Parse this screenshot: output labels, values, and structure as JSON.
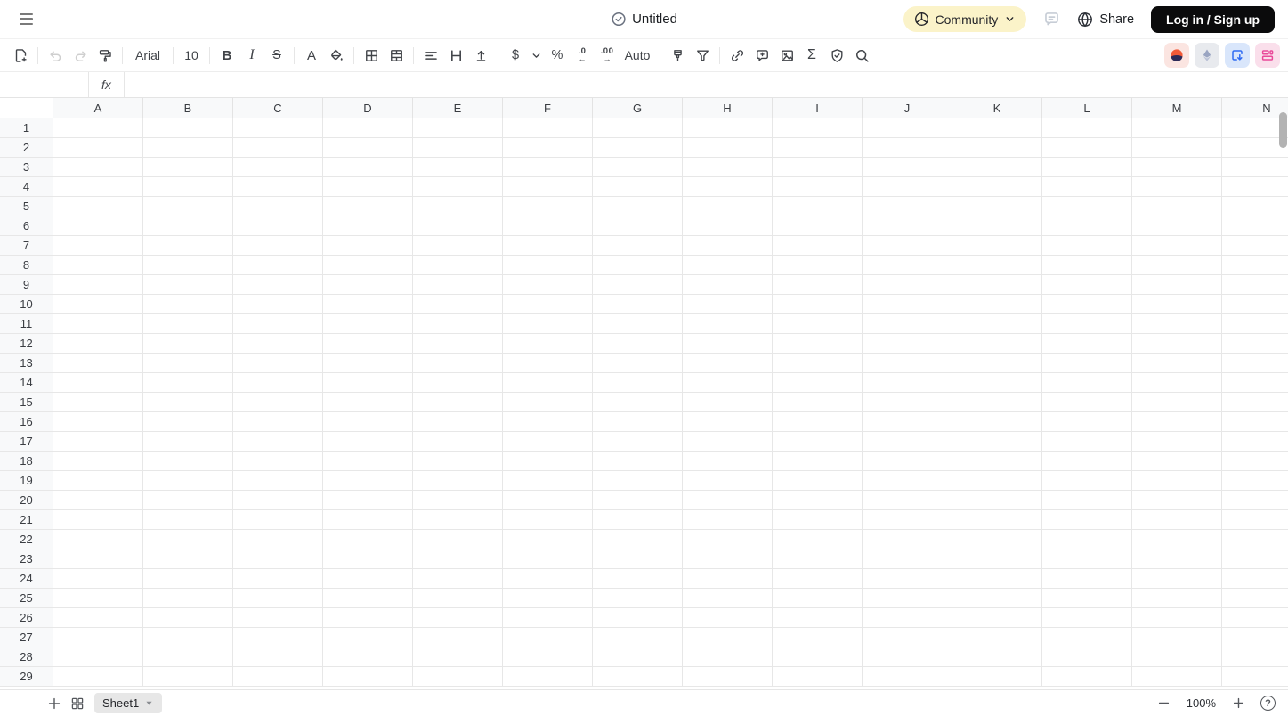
{
  "header": {
    "title": "Untitled",
    "community_label": "Community",
    "share_label": "Share",
    "login_label": "Log in / Sign up"
  },
  "toolbar": {
    "font_family": "Arial",
    "font_size": "10",
    "bold_label": "B",
    "italic_label": "I",
    "strikethrough_label": "S",
    "text_color_label": "A",
    "currency_label": "$",
    "percent_label": "%",
    "decrease_decimal_label": ".0",
    "increase_decimal_label": ".00",
    "decimal_left_arrow": "←",
    "decimal_right_arrow": "→",
    "auto_label": "Auto",
    "sum_label": "Σ"
  },
  "formula_bar": {
    "name_box_value": "",
    "fx_label": "fx",
    "formula_value": ""
  },
  "grid": {
    "columns": [
      "A",
      "B",
      "C",
      "D",
      "E",
      "F",
      "G",
      "H",
      "I",
      "J",
      "K",
      "L",
      "M",
      "N"
    ],
    "rows": [
      "1",
      "2",
      "3",
      "4",
      "5",
      "6",
      "7",
      "8",
      "9",
      "10",
      "11",
      "12",
      "13",
      "14",
      "15",
      "16",
      "17",
      "18",
      "19",
      "20",
      "21",
      "22",
      "23",
      "24",
      "25",
      "26",
      "27",
      "28",
      "29"
    ]
  },
  "footer": {
    "sheet_tab_label": "Sheet1",
    "zoom_level": "100%",
    "help_label": "?"
  },
  "colors": {
    "community_pill_bg": "#FBF3C9",
    "login_button_bg": "#0B0B0C",
    "plugin_sun_bg": "#FBE5E1",
    "plugin_sun_orange": "#F25A38",
    "plugin_sun_navy": "#2C2A58",
    "plugin_eth_bg": "#E8EAEE",
    "plugin_eth_gray": "#9AA5C2",
    "plugin_export_bg": "#D9E6FB",
    "plugin_export_blue": "#2F6BF3",
    "plugin_layout_bg": "#FADFEB",
    "plugin_layout_pink": "#E9499A",
    "grid_header_bg": "#F8F9FA",
    "gridline": "#E7E7E7"
  }
}
